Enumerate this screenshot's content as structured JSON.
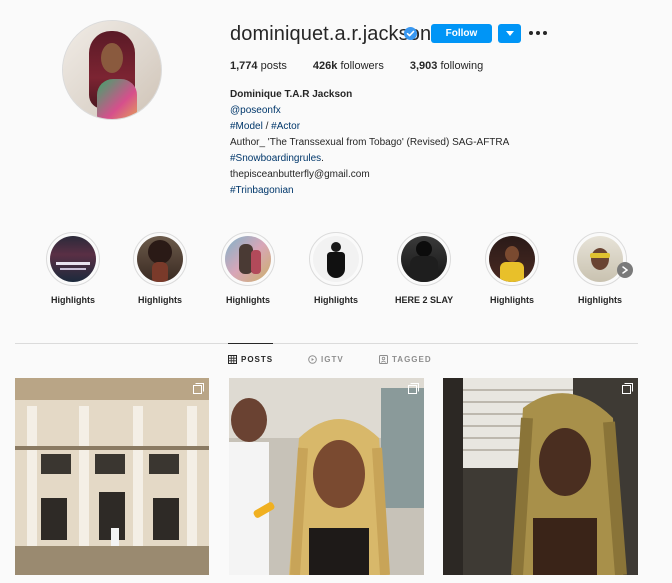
{
  "profile": {
    "username": "dominiquet.a.r.jackson",
    "verified_icon": "verified-badge-icon",
    "follow_label": "Follow",
    "stats": {
      "posts": "1,774",
      "posts_label": "posts",
      "followers": "426k",
      "followers_label": "followers",
      "following": "3,903",
      "following_label": "following"
    },
    "bio": {
      "full_name": "Dominique T.A.R Jackson",
      "mention": "@poseonfx",
      "tags_line_a": "#Model",
      "tags_sep": " / ",
      "tags_line_b": "#Actor",
      "author_line": "Author_ 'The Transsexual from Tobago' (Revised) SAG-AFTRA",
      "hashtag_1": "#Snowboardingrules",
      "hashtag_1_suffix": ".",
      "email": "thepisceanbutterfly@gmail.com",
      "hashtag_2": "#Trinbagonian"
    }
  },
  "highlights": [
    {
      "label": "Highlights"
    },
    {
      "label": "Highlights"
    },
    {
      "label": "Highlights"
    },
    {
      "label": "Highlights"
    },
    {
      "label": "HERE 2 SLAY"
    },
    {
      "label": "Highlights"
    },
    {
      "label": "Highlights"
    }
  ],
  "tabs": [
    {
      "label": "POSTS",
      "icon": "grid-icon",
      "active": true
    },
    {
      "label": "IGTV",
      "icon": "igtv-icon",
      "active": false
    },
    {
      "label": "TAGGED",
      "icon": "tagged-icon",
      "active": false
    }
  ],
  "posts": [
    {
      "icon": "multi-photo-icon"
    },
    {
      "icon": "multi-photo-icon"
    },
    {
      "icon": "multi-photo-icon"
    }
  ],
  "colors": {
    "accent": "#0095f6",
    "link": "#00376b",
    "verified": "#3897f0",
    "background": "#fafafa"
  }
}
